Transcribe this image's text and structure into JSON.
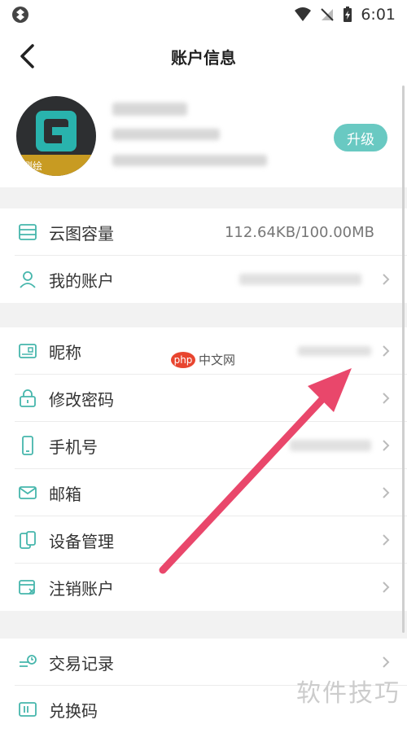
{
  "status_bar": {
    "time": "6:01"
  },
  "nav": {
    "title": "账户信息"
  },
  "profile": {
    "avatar_tag": "测绘",
    "upgrade_label": "升级"
  },
  "rows_group1": [
    {
      "label": "云图容量",
      "value": "112.64KB/100.00MB",
      "icon": "storage-icon"
    },
    {
      "label": "我的账户",
      "value": "",
      "icon": "user-icon"
    }
  ],
  "rows_group2": [
    {
      "label": "昵称",
      "icon": "nickname-icon"
    },
    {
      "label": "修改密码",
      "icon": "lock-icon"
    },
    {
      "label": "手机号",
      "icon": "phone-icon"
    },
    {
      "label": "邮箱",
      "icon": "mail-icon"
    },
    {
      "label": "设备管理",
      "icon": "device-icon"
    },
    {
      "label": "注销账户",
      "icon": "deregister-icon"
    }
  ],
  "rows_group3": [
    {
      "label": "交易记录",
      "icon": "transactions-icon"
    },
    {
      "label": "兑换码",
      "icon": "redeem-icon"
    }
  ],
  "watermarks": {
    "php_badge": "php",
    "php_text": "中文网",
    "bottom": "软件技巧"
  },
  "colors": {
    "accent": "#69c9c2",
    "icon": "#46b6ac",
    "arrow": "#e9476b"
  }
}
